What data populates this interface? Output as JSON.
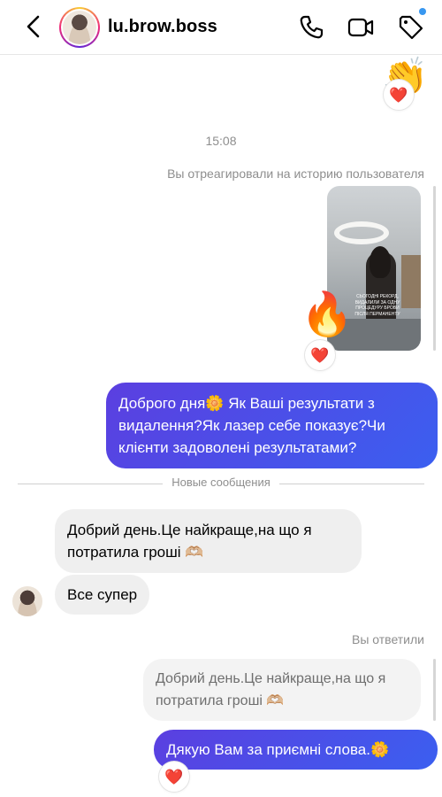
{
  "header": {
    "username": "lu.brow.boss",
    "icons": [
      "back-arrow-icon",
      "phone-icon",
      "video-icon",
      "tag-icon"
    ]
  },
  "chat": {
    "top_emoji": "👏",
    "reaction_heart": "❤️",
    "timestamp": "15:08",
    "story_reply_label": "Вы отреагировали на историю пользователя",
    "story_caption": "СЬОГОДНІ РЕКОРД, ВИДАЛИЛИ ЗА ОДНУ ПРОЦЕДУРУ БРОВИ ПІСЛЯ ПЕРМАНЕНТУ",
    "story_reaction": "🔥",
    "msg_out_1": "Доброго дня🌼 Як Ваші результати з видалення?Як лазер себе показує?Чи клієнти задоволені результатами?",
    "new_messages_label": "Новые сообщения",
    "msg_in_1": "Добрий день.Це найкраще,на що я потратила гроші 🫶🏼",
    "msg_in_2": "Все супер",
    "replied_label": "Вы ответили",
    "quoted_text": "Добрий день.Це найкраще,на що я потратила гроші 🫶🏼",
    "msg_out_2": "Дякую Вам за приємні слова.🌼"
  },
  "colors": {
    "outgoing_bubble": "#4a52e8",
    "incoming_bubble": "#efefef",
    "meta_text": "#8e8e8e",
    "unread_dot": "#3897f0"
  }
}
